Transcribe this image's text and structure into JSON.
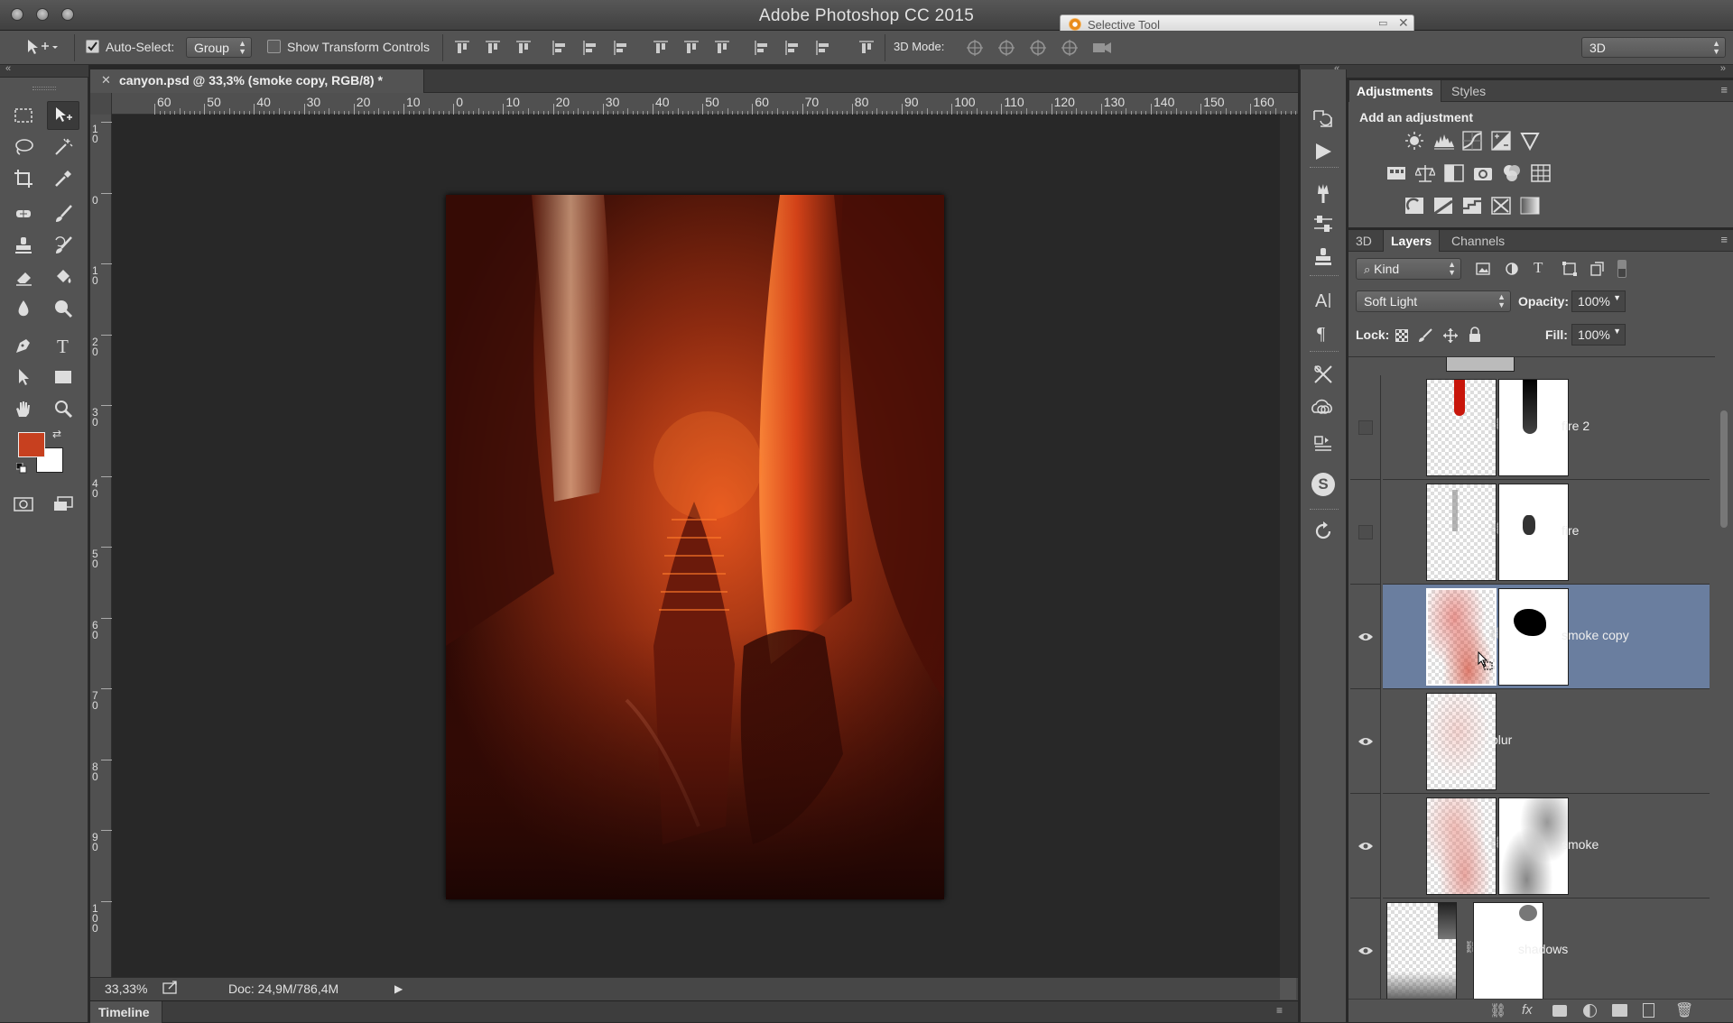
{
  "app": {
    "title": "Adobe Photoshop CC 2015"
  },
  "floating_window": {
    "title": "Selective Tool"
  },
  "options_bar": {
    "auto_select_label": "Auto-Select:",
    "auto_select_checked": true,
    "auto_select_value": "Group",
    "transform_label": "Show Transform Controls",
    "transform_checked": false,
    "mode3d_label": "3D Mode:",
    "workspace_value": "3D"
  },
  "document": {
    "tab_label": "canyon.psd @ 33,3% (smoke copy, RGB/8) *",
    "ruler_h": [
      "60",
      "50",
      "40",
      "30",
      "20",
      "10",
      "0",
      "10",
      "20",
      "30",
      "40",
      "50",
      "60",
      "70",
      "80",
      "90",
      "100",
      "110",
      "120",
      "130",
      "140",
      "150",
      "160"
    ],
    "ruler_v": [
      [
        "1",
        "0"
      ],
      [
        "0"
      ],
      [
        "1",
        "0"
      ],
      [
        "2",
        "0"
      ],
      [
        "3",
        "0"
      ],
      [
        "4",
        "0"
      ],
      [
        "5",
        "0"
      ],
      [
        "6",
        "0"
      ],
      [
        "7",
        "0"
      ],
      [
        "8",
        "0"
      ],
      [
        "9",
        "0"
      ],
      [
        "1",
        "0",
        "0"
      ]
    ],
    "zoom": "33,33%",
    "doc_size": "Doc: 24,9M/786,4M"
  },
  "timeline": {
    "label": "Timeline"
  },
  "colors": {
    "foreground": "#c7401f",
    "background": "#ffffff",
    "selected_layer": "#6a7e9f",
    "panel": "#535353"
  },
  "adjustments": {
    "tabs": [
      "Adjustments",
      "Styles"
    ],
    "heading": "Add an adjustment",
    "rows": [
      [
        "brightness-contrast-icon",
        "levels-icon",
        "curves-icon",
        "exposure-icon",
        "vibrance-icon"
      ],
      [
        "hue-saturation-icon",
        "color-balance-icon",
        "black-white-icon",
        "photo-filter-icon",
        "channel-mixer-icon",
        "color-lookup-icon"
      ],
      [
        "invert-icon",
        "posterize-icon",
        "threshold-icon",
        "selective-color-icon",
        "gradient-map-icon"
      ]
    ]
  },
  "layers_panel": {
    "tabs": [
      "3D",
      "Layers",
      "Channels"
    ],
    "filter_label": "Kind",
    "blend_mode": "Soft Light",
    "opacity_label": "Opacity:",
    "opacity_value": "100%",
    "lock_label": "Lock:",
    "fill_label": "Fill:",
    "fill_value": "100%",
    "layers": [
      {
        "name": "fire 2",
        "visible": false,
        "has_mask": true,
        "selected": false
      },
      {
        "name": "fire",
        "visible": false,
        "has_mask": true,
        "selected": false
      },
      {
        "name": "smoke copy",
        "visible": true,
        "has_mask": true,
        "selected": true
      },
      {
        "name": "blur",
        "visible": true,
        "has_mask": false,
        "selected": false
      },
      {
        "name": "smoke",
        "visible": true,
        "has_mask": true,
        "selected": false
      },
      {
        "name": "shadows",
        "visible": true,
        "has_mask": true,
        "selected": false
      }
    ]
  }
}
